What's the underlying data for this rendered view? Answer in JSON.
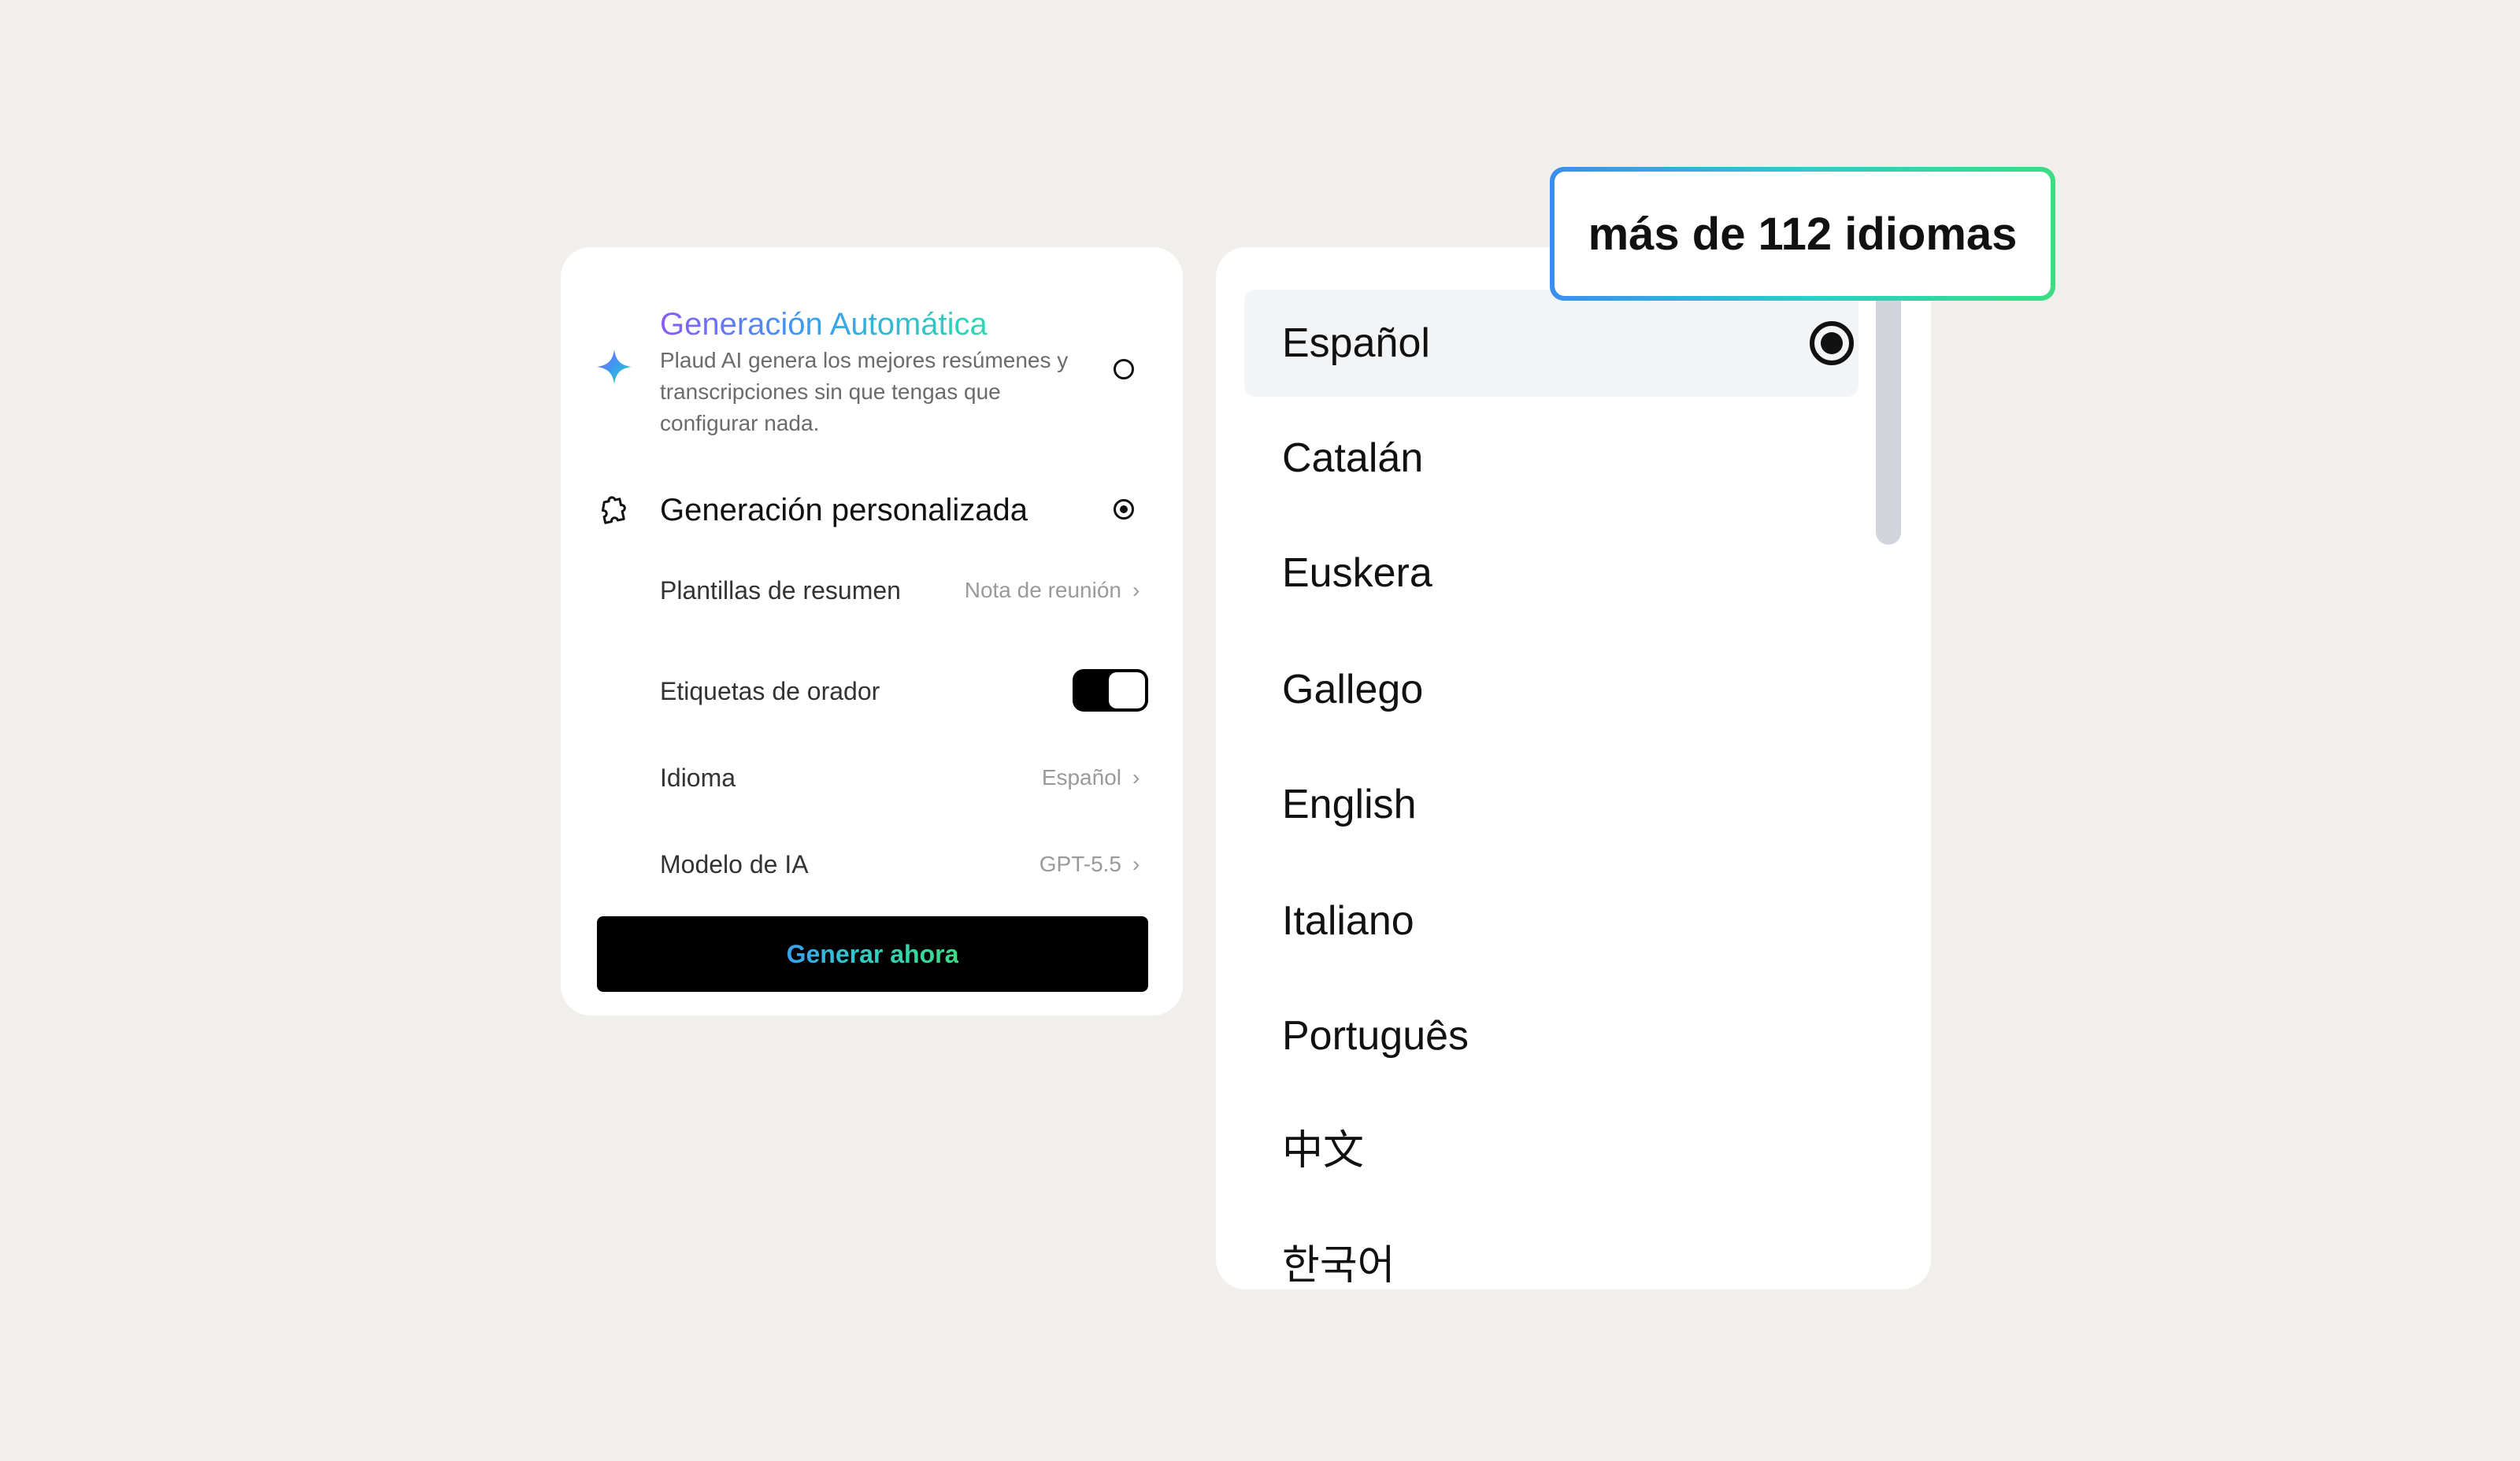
{
  "settings": {
    "auto": {
      "title": "Generación Automática",
      "description": "Plaud AI genera los mejores resúmenes y transcripciones sin que tengas que configurar nada.",
      "selected": false
    },
    "custom": {
      "title": "Generación personalizada",
      "selected": true
    },
    "rows": {
      "templates": {
        "label": "Plantillas de resumen",
        "value": "Nota de reunión"
      },
      "speaker_labels": {
        "label": "Etiquetas de orador",
        "enabled": true
      },
      "language": {
        "label": "Idioma",
        "value": "Español"
      },
      "ai_model": {
        "label": "Modelo de IA",
        "value": "GPT-5.5"
      }
    },
    "generate_button": "Generar ahora"
  },
  "languages": {
    "items": [
      {
        "label": "Español",
        "selected": true
      },
      {
        "label": "Catalán"
      },
      {
        "label": "Euskera"
      },
      {
        "label": "Gallego"
      },
      {
        "label": "English"
      },
      {
        "label": "Italiano"
      },
      {
        "label": "Português"
      },
      {
        "label": "中文"
      },
      {
        "label": "한국어"
      }
    ]
  },
  "callout": {
    "text": "más de 112 idiomas"
  },
  "colors": {
    "background": "#f0efec",
    "card": "#ffffff",
    "accent_gradient": [
      "#3a8ef0",
      "#3ddc84"
    ],
    "title_gradient": [
      "#8a5cf6",
      "#2fd9b0"
    ]
  },
  "icons": {
    "auto": "sparkle-icon",
    "custom": "puzzle-icon",
    "chevron": "chevron-right-icon"
  }
}
